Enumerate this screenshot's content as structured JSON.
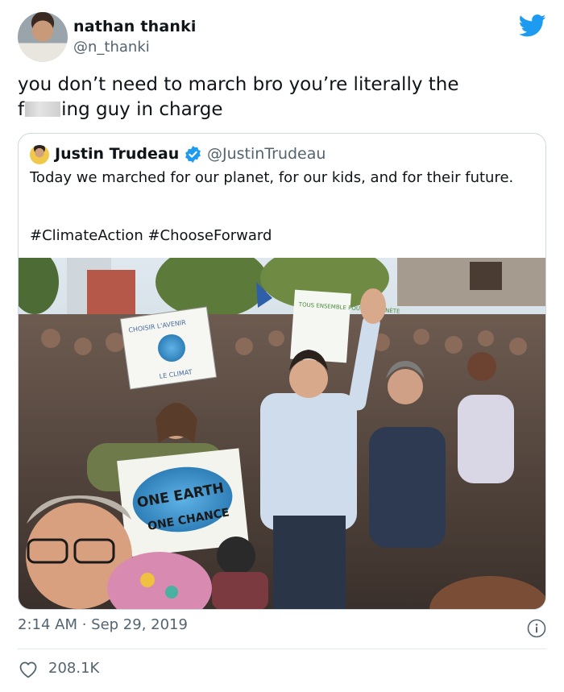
{
  "tweet": {
    "author_name": "nathan thanki",
    "author_handle": "@n_thanki",
    "text_line1": "you don’t need to march bro you’re literally the",
    "text_line2_start": "f",
    "text_line2_end": "ing guy in charge",
    "timestamp": "2:14 AM · Sep 29, 2019",
    "likes": "208.1K"
  },
  "quoted": {
    "author_name": "Justin Trudeau",
    "author_handle": "@JustinTrudeau",
    "text": "Today we marched for our planet, for our kids, and for their future.",
    "hashtags": "#ClimateAction #ChooseForward",
    "photo_signs": {
      "left": "CHOISIR L'AVENIR",
      "left_small": "LE CLIMAT",
      "center": "TOUS ENSEMBLE POUR LA PLANÈTE",
      "bottom_line1": "ONE EARTH",
      "bottom_line2": "ONE CHANCE"
    }
  },
  "colors": {
    "twitter_blue": "#1d9bf0",
    "text_primary": "#0f1419",
    "text_secondary": "#536471",
    "border": "#cfd9de"
  },
  "icons": {
    "brand": "twitter-bird-icon",
    "verified": "verified-badge-icon",
    "info": "info-icon",
    "like": "heart-icon"
  }
}
